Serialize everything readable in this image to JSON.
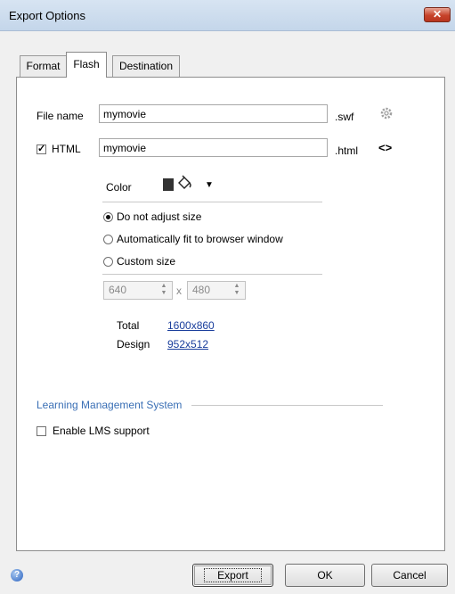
{
  "window": {
    "title": "Export Options",
    "close": "✕"
  },
  "tabs": [
    "Format",
    "Flash",
    "Destination"
  ],
  "file_name": {
    "label": "File name",
    "value": "mymovie",
    "ext": ".swf"
  },
  "html": {
    "label": "HTML",
    "checked": true,
    "value": "mymovie",
    "ext": ".html",
    "icon_glyph": "<>"
  },
  "color": {
    "label": "Color",
    "swatch": "#333333"
  },
  "size_options": [
    {
      "label": "Do not adjust size",
      "selected": true
    },
    {
      "label": "Automatically fit to browser window",
      "selected": false
    },
    {
      "label": "Custom size",
      "selected": false
    }
  ],
  "custom_size": {
    "width": "640",
    "height": "480",
    "sep": "x"
  },
  "total": {
    "label": "Total",
    "value": "1600x860"
  },
  "design": {
    "label": "Design",
    "value": "952x512"
  },
  "lms": {
    "section_title": "Learning Management System",
    "enable_label": "Enable LMS support",
    "checked": false
  },
  "buttons": {
    "export": "Export",
    "ok": "OK",
    "cancel": "Cancel"
  }
}
